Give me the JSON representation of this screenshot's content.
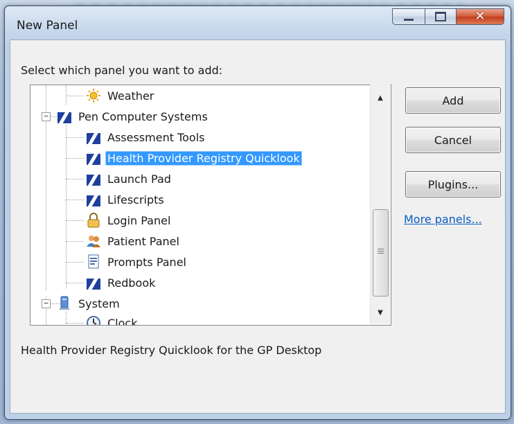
{
  "window": {
    "title": "New Panel",
    "controls": {
      "minimize_icon": "minimize-icon",
      "maximize_icon": "maximize-icon",
      "close_icon": "close-icon"
    }
  },
  "prompt_label": "Select which panel you want to add:",
  "tree": {
    "items": [
      {
        "label": "Weather",
        "icon": "weather-icon",
        "level": 1,
        "selected": false
      },
      {
        "label": "Pen Computer Systems",
        "icon": "pen-logo-icon",
        "level": 0,
        "expanded": true,
        "selected": false
      },
      {
        "label": "Assessment Tools",
        "icon": "pen-logo-icon",
        "level": 1,
        "selected": false
      },
      {
        "label": "Health Provider Registry Quicklook",
        "icon": "pen-logo-icon",
        "level": 1,
        "selected": true
      },
      {
        "label": "Launch Pad",
        "icon": "pen-logo-icon",
        "level": 1,
        "selected": false
      },
      {
        "label": "Lifescripts",
        "icon": "pen-logo-icon",
        "level": 1,
        "selected": false
      },
      {
        "label": "Login Panel",
        "icon": "padlock-icon",
        "level": 1,
        "selected": false
      },
      {
        "label": "Patient Panel",
        "icon": "patients-icon",
        "level": 1,
        "selected": false
      },
      {
        "label": "Prompts Panel",
        "icon": "document-icon",
        "level": 1,
        "selected": false
      },
      {
        "label": "Redbook",
        "icon": "pen-logo-icon",
        "level": 1,
        "selected": false
      },
      {
        "label": "System",
        "icon": "computer-icon",
        "level": 0,
        "expanded": true,
        "selected": false
      },
      {
        "label": "Clock",
        "icon": "clock-icon",
        "level": 1,
        "selected": false
      }
    ]
  },
  "buttons": {
    "add": "Add",
    "cancel": "Cancel",
    "plugins": "Plugins..."
  },
  "more_panels_link": "More panels...",
  "description": "Health Provider Registry Quicklook for the GP Desktop",
  "colors": {
    "selection": "#3399ff",
    "link": "#0a5bc4",
    "close_button": "#c23e1d"
  }
}
